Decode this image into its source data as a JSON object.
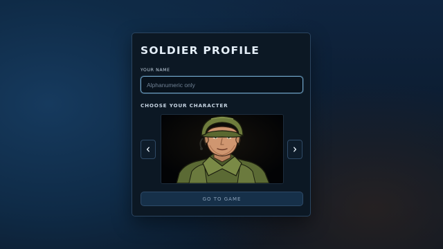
{
  "panel": {
    "title": "SOLDIER PROFILE",
    "name_label": "YOUR NAME",
    "name_placeholder": "Alphanumeric only",
    "name_value": "",
    "character_label": "CHOOSE YOUR CHARACTER",
    "prev_icon": "chevron-left-icon",
    "next_icon": "chevron-right-icon",
    "submit_label": "GO TO GAME"
  },
  "colors": {
    "panel_bg": "#0c1824",
    "input_border": "#6fa2c6",
    "button_bg": "#163049",
    "title_text": "#e4eef8"
  }
}
